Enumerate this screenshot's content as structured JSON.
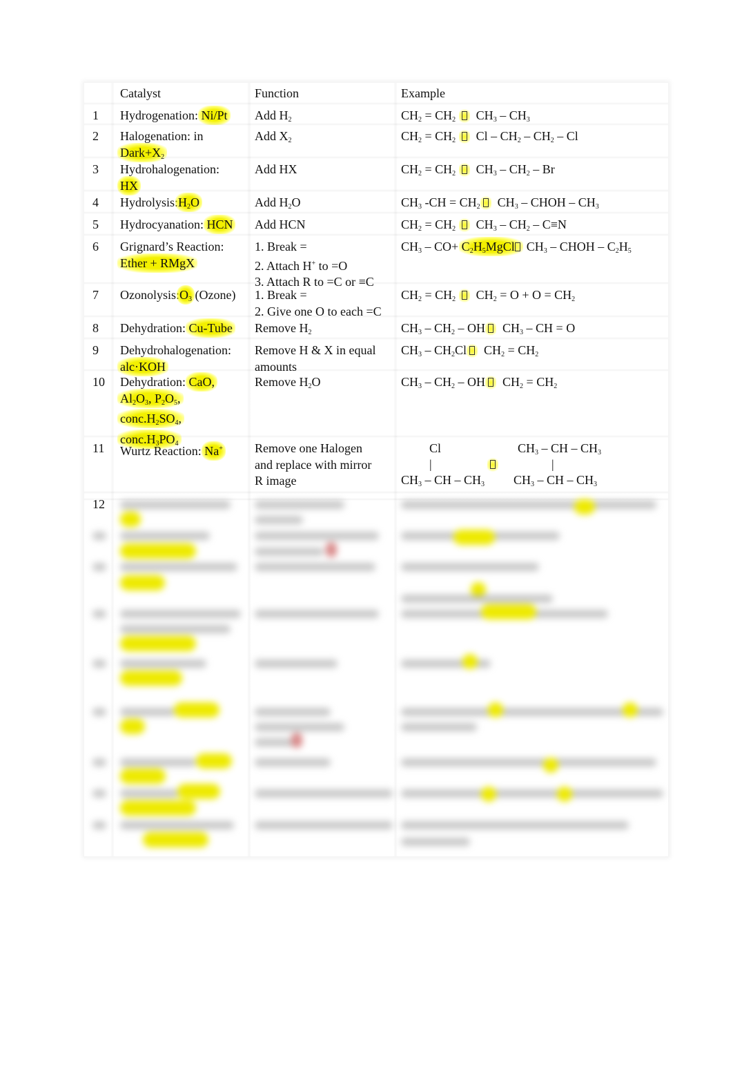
{
  "document": {
    "headers": {
      "number": "",
      "catalyst": "Catalyst",
      "function": "Function",
      "example": "Example"
    },
    "rows": [
      {
        "num": "1",
        "catalyst_plain": "Hydrogenation: ",
        "catalyst_hl": "Ni/Pt",
        "function": "Add H2",
        "example": "CH2 = CH2 → CH3 – CH3"
      },
      {
        "num": "2",
        "catalyst_plain": "Halogenation: in",
        "catalyst_hl": "Dark+X2",
        "function": "Add X2",
        "example": "CH2 = CH2 → Cl – CH2 – CH2 – Cl"
      },
      {
        "num": "3",
        "catalyst_plain": "Hydrohalogenation:",
        "catalyst_hl": "HX",
        "function": "Add HX",
        "example": "CH2 = CH2 → CH3 – CH2 – Br"
      },
      {
        "num": "4",
        "catalyst_plain": "Hydrolysis:",
        "catalyst_hl": "H2O",
        "function": "Add H2O",
        "example": "CH3 -CH = CH2 → CH3 – CHOH – CH3"
      },
      {
        "num": "5",
        "catalyst_plain": "Hydrocyanation: ",
        "catalyst_hl": "HCN",
        "function": "Add HCN",
        "example": "CH2 = CH2 → CH3 – CH2 – C≡N"
      },
      {
        "num": "6",
        "catalyst_plain": "Grignard’s Reaction:",
        "catalyst_hl": "Ether + RMgX",
        "function_lines": [
          "1. Break =",
          "2. Attach H+ to =O",
          "3. Attach R to =C or ≡C"
        ],
        "example": "CH3 – CO+ C2H5MgCl → CH3 – CHOH – C2H5"
      },
      {
        "num": "7",
        "catalyst_plain": "Ozonolysis:",
        "catalyst_hl": "O3",
        "catalyst_suffix": " (Ozone)",
        "function_lines": [
          "1. Break =",
          "2. Give one O to each =C"
        ],
        "example": "CH2 = CH2 → CH2 = O + O = CH2"
      },
      {
        "num": "8",
        "catalyst_plain": "Dehydration: ",
        "catalyst_hl": "Cu-Tube",
        "function": "Remove H2",
        "example": "CH3 – CH2 – OH → CH3 – CH = O"
      },
      {
        "num": "9",
        "catalyst_plain": "Dehydrohalogenation:",
        "catalyst_hl": "alc·KOH",
        "function_lines": [
          "Remove H & X in equal",
          "amounts"
        ],
        "example": "CH3 – CH2Cl → CH2 = CH2"
      },
      {
        "num": "10",
        "catalyst_plain": "Dehydration: ",
        "catalyst_hl_lines": [
          "CaO,",
          "Al2O3, P2O5,",
          "conc.H2SO4,",
          "conc.H3PO4"
        ],
        "function": "Remove H2O",
        "example": "CH3 – CH2 – OH → CH2 = CH2"
      },
      {
        "num": "11",
        "catalyst_plain": "Wurtz Reaction: ",
        "catalyst_hl": "Na+",
        "function_lines": [
          "Remove one Halogen",
          "and replace with mirror",
          "R image"
        ],
        "example_lines": [
          "Cl",
          "|",
          "CH3 – CH – CH3",
          "CH3 – CH – CH3",
          "|",
          "CH3 – CH – CH3"
        ]
      },
      {
        "num": "12",
        "blurred": true
      }
    ],
    "blurred_preview_note": "rows 12+ obscured"
  },
  "colors": {
    "highlight": "#f3f000",
    "text": "#111111",
    "annotation_red": "#d98a8a"
  }
}
